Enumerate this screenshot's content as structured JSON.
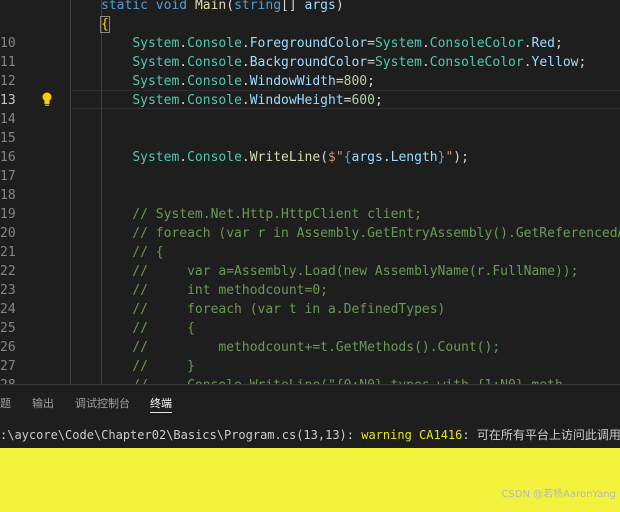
{
  "editor": {
    "active_line": "13",
    "lines": [
      {
        "n": "",
        "tokens": [
          {
            "c": "kw",
            "t": "static"
          },
          {
            "c": "pn",
            "t": " "
          },
          {
            "c": "kw",
            "t": "void"
          },
          {
            "c": "pn",
            "t": " "
          },
          {
            "c": "fn",
            "t": "Main"
          },
          {
            "c": "pn",
            "t": "("
          },
          {
            "c": "kw",
            "t": "string"
          },
          {
            "c": "pn",
            "t": "[] "
          },
          {
            "c": "pr",
            "t": "args"
          },
          {
            "c": "pn",
            "t": ")"
          }
        ]
      },
      {
        "n": "",
        "tokens": [
          {
            "c": "br",
            "t": "{"
          }
        ]
      },
      {
        "n": "10",
        "tokens": [
          {
            "c": "pn",
            "t": "    "
          },
          {
            "c": "ty",
            "t": "System"
          },
          {
            "c": "pn",
            "t": "."
          },
          {
            "c": "ty",
            "t": "Console"
          },
          {
            "c": "pn",
            "t": "."
          },
          {
            "c": "pr",
            "t": "ForegroundColor"
          },
          {
            "c": "pn",
            "t": "="
          },
          {
            "c": "ty",
            "t": "System"
          },
          {
            "c": "pn",
            "t": "."
          },
          {
            "c": "ty",
            "t": "ConsoleColor"
          },
          {
            "c": "pn",
            "t": "."
          },
          {
            "c": "pr",
            "t": "Red"
          },
          {
            "c": "pn",
            "t": ";"
          }
        ]
      },
      {
        "n": "11",
        "tokens": [
          {
            "c": "pn",
            "t": "    "
          },
          {
            "c": "ty",
            "t": "System"
          },
          {
            "c": "pn",
            "t": "."
          },
          {
            "c": "ty",
            "t": "Console"
          },
          {
            "c": "pn",
            "t": "."
          },
          {
            "c": "pr",
            "t": "BackgroundColor"
          },
          {
            "c": "pn",
            "t": "="
          },
          {
            "c": "ty",
            "t": "System"
          },
          {
            "c": "pn",
            "t": "."
          },
          {
            "c": "ty",
            "t": "ConsoleColor"
          },
          {
            "c": "pn",
            "t": "."
          },
          {
            "c": "pr",
            "t": "Yellow"
          },
          {
            "c": "pn",
            "t": ";"
          }
        ]
      },
      {
        "n": "12",
        "tokens": [
          {
            "c": "pn",
            "t": "    "
          },
          {
            "c": "ty",
            "t": "System"
          },
          {
            "c": "pn",
            "t": "."
          },
          {
            "c": "ty",
            "t": "Console"
          },
          {
            "c": "pn",
            "t": "."
          },
          {
            "c": "pr",
            "t": "WindowWidth"
          },
          {
            "c": "pn",
            "t": "="
          },
          {
            "c": "num",
            "t": "800"
          },
          {
            "c": "pn",
            "t": ";"
          }
        ]
      },
      {
        "n": "13",
        "tokens": [
          {
            "c": "pn",
            "t": "    "
          },
          {
            "c": "ty",
            "t": "System"
          },
          {
            "c": "pn",
            "t": "."
          },
          {
            "c": "ty",
            "t": "Console"
          },
          {
            "c": "pn",
            "t": "."
          },
          {
            "c": "pr",
            "t": "WindowHeight"
          },
          {
            "c": "pn",
            "t": "="
          },
          {
            "c": "num",
            "t": "600"
          },
          {
            "c": "pn",
            "t": ";"
          }
        ]
      },
      {
        "n": "14",
        "tokens": []
      },
      {
        "n": "15",
        "tokens": []
      },
      {
        "n": "16",
        "tokens": [
          {
            "c": "pn",
            "t": "    "
          },
          {
            "c": "ty",
            "t": "System"
          },
          {
            "c": "pn",
            "t": "."
          },
          {
            "c": "ty",
            "t": "Console"
          },
          {
            "c": "pn",
            "t": "."
          },
          {
            "c": "fn",
            "t": "WriteLine"
          },
          {
            "c": "pn",
            "t": "("
          },
          {
            "c": "str",
            "t": "$\""
          },
          {
            "c": "kw",
            "t": "{"
          },
          {
            "c": "pr",
            "t": "args"
          },
          {
            "c": "pn",
            "t": "."
          },
          {
            "c": "pr",
            "t": "Length"
          },
          {
            "c": "kw",
            "t": "}"
          },
          {
            "c": "str",
            "t": "\""
          },
          {
            "c": "pn",
            "t": ");"
          }
        ]
      },
      {
        "n": "17",
        "tokens": []
      },
      {
        "n": "18",
        "tokens": []
      },
      {
        "n": "19",
        "tokens": [
          {
            "c": "cm",
            "t": "    // System.Net.Http.HttpClient client;"
          }
        ]
      },
      {
        "n": "20",
        "tokens": [
          {
            "c": "cm",
            "t": "    // foreach (var r in Assembly.GetEntryAssembly().GetReferencedAs"
          }
        ]
      },
      {
        "n": "21",
        "tokens": [
          {
            "c": "cm",
            "t": "    // {"
          }
        ]
      },
      {
        "n": "22",
        "tokens": [
          {
            "c": "cm",
            "t": "    //     var a=Assembly.Load(new AssemblyName(r.FullName));"
          }
        ]
      },
      {
        "n": "23",
        "tokens": [
          {
            "c": "cm",
            "t": "    //     int methodcount=0;"
          }
        ]
      },
      {
        "n": "24",
        "tokens": [
          {
            "c": "cm",
            "t": "    //     foreach (var t in a.DefinedTypes)"
          }
        ]
      },
      {
        "n": "25",
        "tokens": [
          {
            "c": "cm",
            "t": "    //     {"
          }
        ]
      },
      {
        "n": "26",
        "tokens": [
          {
            "c": "cm",
            "t": "    //         methodcount+=t.GetMethods().Count();"
          }
        ]
      },
      {
        "n": "27",
        "tokens": [
          {
            "c": "cm",
            "t": "    //     }"
          }
        ]
      },
      {
        "n": "28",
        "tokens": [
          {
            "c": "cm",
            "t": "    //     Console.WriteLine(\"{0:N0} types with {1:N0} meth"
          }
        ]
      }
    ]
  },
  "panel": {
    "tabs": [
      {
        "label": "题",
        "active": false
      },
      {
        "label": "输出",
        "active": false
      },
      {
        "label": "调试控制台",
        "active": false
      },
      {
        "label": "终端",
        "active": true
      }
    ]
  },
  "terminal": {
    "path": ":\\aycore\\Code\\Chapter02\\Basics\\Program.cs(13,13): ",
    "warning": "warning CA1416",
    "message": ": 可在所有平台上访问此调用"
  },
  "console_background": "#f3f33d",
  "watermark": "CSDN @若杨AaronYang"
}
